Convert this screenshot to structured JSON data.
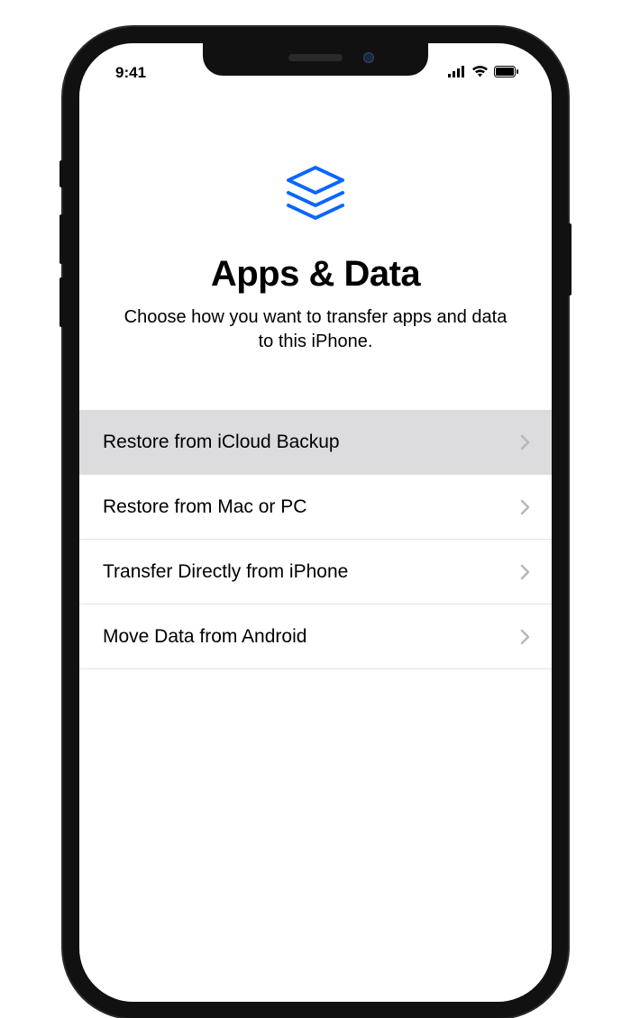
{
  "status": {
    "time": "9:41"
  },
  "header": {
    "title": "Apps & Data",
    "subtitle": "Choose how you want to transfer apps and data to this iPhone."
  },
  "options": [
    {
      "label": "Restore from iCloud Backup",
      "selected": true
    },
    {
      "label": "Restore from Mac or PC",
      "selected": false
    },
    {
      "label": "Transfer Directly from iPhone",
      "selected": false
    },
    {
      "label": "Move Data from Android",
      "selected": false
    }
  ],
  "colors": {
    "accent": "#0a66ff",
    "separator": "#e2e2e5",
    "selected_bg": "#dcdcdf"
  }
}
